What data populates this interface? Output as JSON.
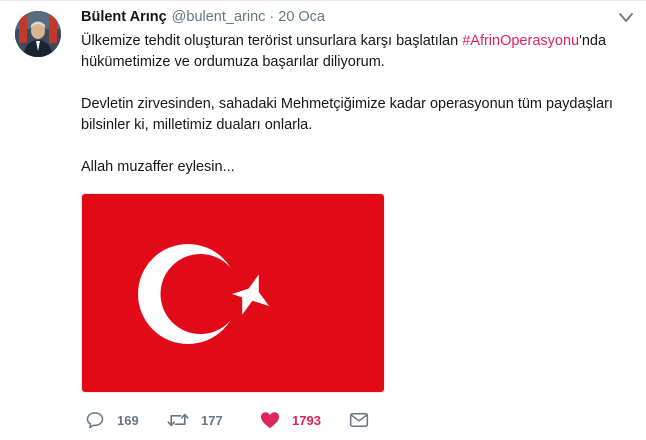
{
  "tweet": {
    "author": {
      "display_name": "Bülent Arınç",
      "username": "@bulent_arinc"
    },
    "separator": "·",
    "timestamp": "20 Oca",
    "text": {
      "p1_before": "Ülkemize tehdit oluşturan terörist unsurlara karşı başlatılan ",
      "p1_hashtag": "#AfrinOperasyonu",
      "p1_after": "'nda hükümetimize ve ordumuza başarılar diliyorum.",
      "p2": "Devletin zirvesinden, sahadaki Mehmetçiğimize kadar operasyonun tüm paydaşları bilsinler ki, milletimiz duaları onlarla.",
      "p3": "Allah muzaffer eylesin..."
    },
    "media": {
      "description": "turkish-flag-image",
      "flag_red": "#e30a17",
      "flag_white": "#ffffff"
    },
    "actions": {
      "reply_count": "169",
      "retweet_count": "177",
      "like_count": "1793"
    },
    "colors": {
      "hashtag": "#e0245e",
      "like": "#e0245e",
      "secondary_text": "#657786"
    }
  }
}
